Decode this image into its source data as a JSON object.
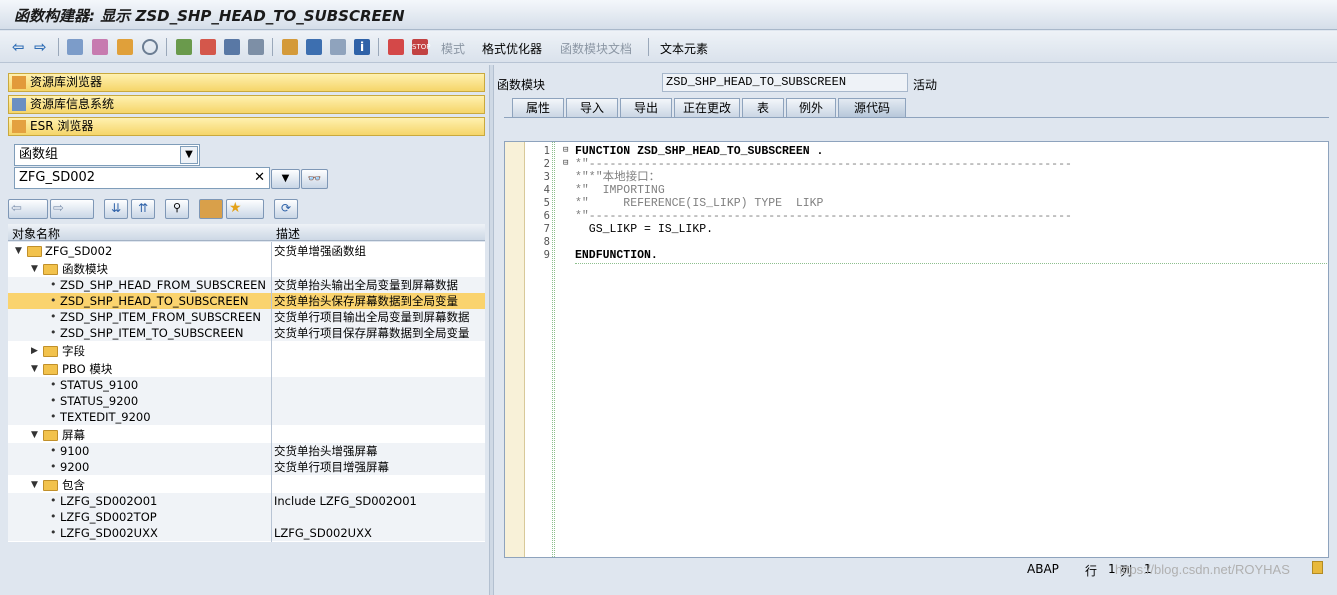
{
  "window_title": "函数构建器: 显示 ZSD_SHP_HEAD_TO_SUBSCREEN",
  "toolbar": {
    "pattern": "模式",
    "pretty_printer": "格式优化器",
    "fm_doc": "函数模块文档",
    "text_elements": "文本元素"
  },
  "nav": {
    "repo_browser": "资源库浏览器",
    "repo_info": "资源库信息系统",
    "esr_browser": "ESR 浏览器"
  },
  "object_type": {
    "value": "函数组"
  },
  "object_name": {
    "value": "ZFG_SD002"
  },
  "tree": {
    "col_name": "对象名称",
    "col_desc": "描述",
    "rows": [
      {
        "name": "ZFG_SD002",
        "desc": "交货单增强函数组"
      },
      {
        "name": "函数模块",
        "desc": ""
      },
      {
        "name": "ZSD_SHP_HEAD_FROM_SUBSCREEN",
        "desc": "交货单抬头输出全局变量到屏幕数据"
      },
      {
        "name": "ZSD_SHP_HEAD_TO_SUBSCREEN",
        "desc": "交货单抬头保存屏幕数据到全局变量"
      },
      {
        "name": "ZSD_SHP_ITEM_FROM_SUBSCREEN",
        "desc": "交货单行项目输出全局变量到屏幕数据"
      },
      {
        "name": "ZSD_SHP_ITEM_TO_SUBSCREEN",
        "desc": "交货单行项目保存屏幕数据到全局变量"
      },
      {
        "name": "字段",
        "desc": ""
      },
      {
        "name": "PBO 模块",
        "desc": ""
      },
      {
        "name": "STATUS_9100",
        "desc": ""
      },
      {
        "name": "STATUS_9200",
        "desc": ""
      },
      {
        "name": "TEXTEDIT_9200",
        "desc": ""
      },
      {
        "name": "屏幕",
        "desc": ""
      },
      {
        "name": "9100",
        "desc": "交货单抬头增强屏幕"
      },
      {
        "name": "9200",
        "desc": "交货单行项目增强屏幕"
      },
      {
        "name": "包含",
        "desc": ""
      },
      {
        "name": "LZFG_SD002O01",
        "desc": "Include LZFG_SD002O01"
      },
      {
        "name": "LZFG_SD002TOP",
        "desc": ""
      },
      {
        "name": "LZFG_SD002UXX",
        "desc": "LZFG_SD002UXX"
      }
    ]
  },
  "fm": {
    "label": "函数模块",
    "name": "ZSD_SHP_HEAD_TO_SUBSCREEN",
    "status": "活动"
  },
  "tabs": [
    "属性",
    "导入",
    "导出",
    "正在更改",
    "表",
    "例外",
    "源代码"
  ],
  "code": {
    "lines": [
      "FUNCTION ZSD_SHP_HEAD_TO_SUBSCREEN .",
      "*\"----------------------------------------------------------------------",
      "*\"*\"本地接口：",
      "*\"  IMPORTING",
      "*\"     REFERENCE(IS_LIKP) TYPE  LIKP",
      "*\"----------------------------------------------------------------------",
      "  GS_LIKP = IS_LIKP.",
      "",
      "ENDFUNCTION."
    ],
    "numbers": [
      "1",
      "2",
      "3",
      "4",
      "5",
      "6",
      "7",
      "8",
      "9"
    ]
  },
  "status": {
    "lang": "ABAP",
    "row_label": "行",
    "row_val": "1",
    "col_label": "列",
    "col_val": "1"
  },
  "watermark": "https://blog.csdn.net/ROYHAS"
}
